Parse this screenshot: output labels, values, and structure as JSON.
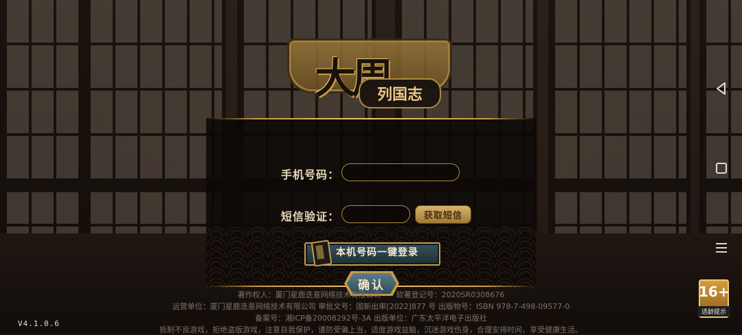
{
  "logo": {
    "main": "大周",
    "sub": "列国志"
  },
  "form": {
    "phone_label": "手机号码：",
    "phone_value": "",
    "sms_label": "短信验证：",
    "sms_value": "",
    "get_sms_button": "获取短信",
    "one_click_login_button": "本机号码一键登录",
    "confirm_button": "确认"
  },
  "legal": {
    "line1": "著作权人：厦门星鹿迭意网络技术有限公司　　软著登记号：2020SR0308676",
    "line2": "运营单位：厦门星鹿迭意网络技术有限公司 审批文号：国新出审[2022]877 号 出版物号：ISBN 978-7-498-09577-0",
    "line3": "备案号：湘ICP备20008292号-3A 出版单位：广东太平洋电子出版社",
    "line4": "抵制不良游戏，拒绝盗版游戏，注意自我保护，谨防受骗上当，适度游戏益脑，沉迷游戏伤身，合理安排时间，享受健康生活。"
  },
  "version": "V4.1.0.6",
  "age_rating": {
    "number": "16+",
    "tip": "适龄提示"
  },
  "colors": {
    "gold": "#c89a48",
    "text_light": "#e8d8b8",
    "button_teal": "#2f4b57"
  },
  "icons": {
    "nav_back": "triangle-left",
    "nav_home": "square",
    "nav_menu": "three-lines"
  }
}
